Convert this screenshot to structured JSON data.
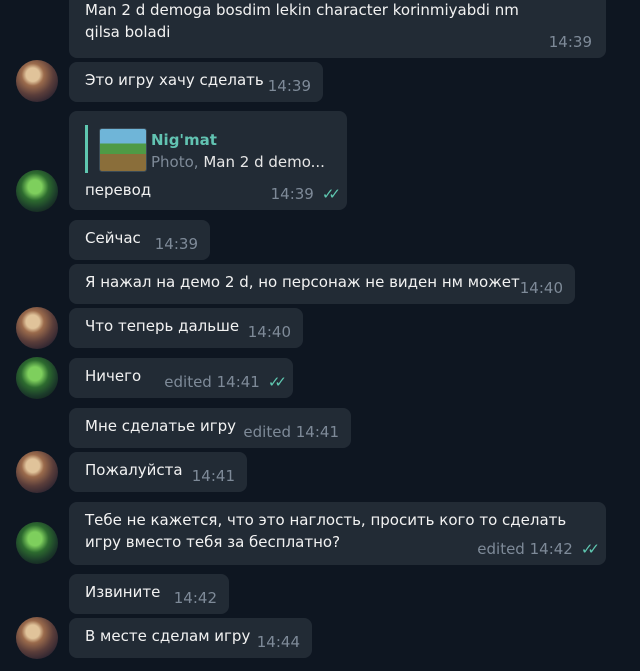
{
  "messages": [
    {
      "sender": "user",
      "text": "Man 2 d demoga bosdim lekin character korinmiyabdi nm qilsa boladi",
      "time": "14:39",
      "edited": false
    },
    {
      "sender": "user",
      "text": "Это игру хачу сделать",
      "time": "14:39",
      "edited": false
    },
    {
      "sender": "me",
      "reply_to": {
        "name": "Nig'mat",
        "kind": "Photo,",
        "preview": "Man 2 d demo..."
      },
      "text": "перевод",
      "time": "14:39",
      "edited": false,
      "read": true
    },
    {
      "sender": "user",
      "text": "Сейчас",
      "time": "14:39",
      "edited": false
    },
    {
      "sender": "user",
      "text": "Я нажал на демо 2 d, но персонаж не виден нм может",
      "time": "14:40",
      "edited": false
    },
    {
      "sender": "user",
      "text": "Что теперь дальше",
      "time": "14:40",
      "edited": false
    },
    {
      "sender": "me",
      "text": "Ничего",
      "time": "14:41",
      "edited": true,
      "read": true
    },
    {
      "sender": "user",
      "text": "Мне сделатье игру",
      "time": "14:41",
      "edited": true
    },
    {
      "sender": "user",
      "text": "Пожалуйста",
      "time": "14:41",
      "edited": false
    },
    {
      "sender": "me",
      "text": "Тебе не кажется, что это наглость, просить кого то сделать игру вместо тебя за бесплатно?",
      "time": "14:42",
      "edited": true,
      "read": true
    },
    {
      "sender": "user",
      "text": "Извините",
      "time": "14:42",
      "edited": false
    },
    {
      "sender": "user",
      "text": "В месте сделам игру",
      "time": "14:44",
      "edited": false
    }
  ],
  "labels": {
    "edited": "edited",
    "read_icon": "double-check-icon"
  },
  "colors": {
    "background": "#0e1621",
    "bubble": "#222b35",
    "accent": "#5fc7b0",
    "meta": "#7e8a98"
  }
}
